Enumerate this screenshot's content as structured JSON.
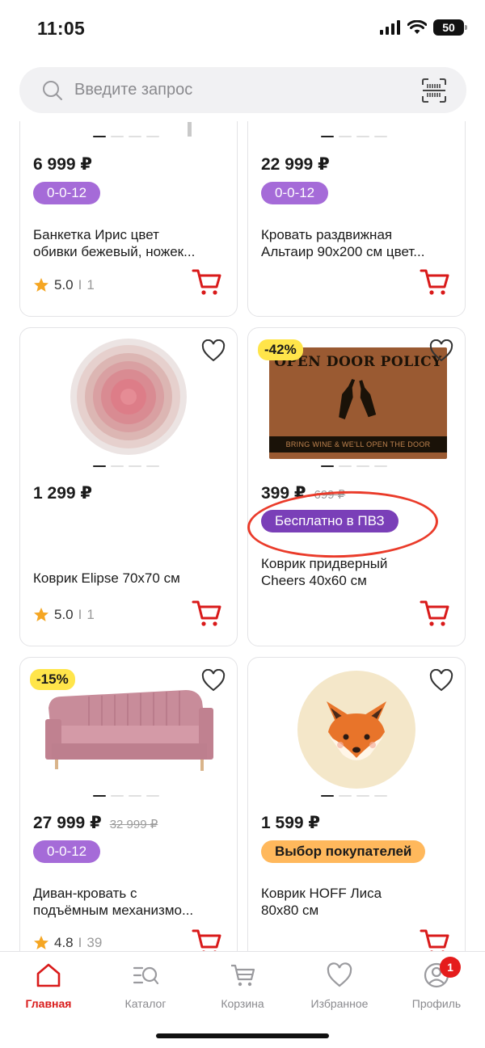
{
  "status_bar": {
    "time": "11:05",
    "battery": "50"
  },
  "search": {
    "placeholder": "Введите запрос"
  },
  "products": [
    {
      "price": "6 999 ₽",
      "old_price": "",
      "badge": "0-0-12",
      "title_line1": "Банкетка Ирис цвет",
      "title_line2": "обивки бежевый, ножек...",
      "rating": "5.0",
      "reviews": "1",
      "discount": ""
    },
    {
      "price": "22 999 ₽",
      "old_price": "",
      "badge": "0-0-12",
      "title_line1": "Кровать раздвижная",
      "title_line2": "Альтаир 90х200 см цвет...",
      "rating": "",
      "reviews": "",
      "discount": ""
    },
    {
      "price": "1 299 ₽",
      "old_price": "",
      "badge": "",
      "title_line1": "Коврик Elipse 70x70 см",
      "title_line2": "",
      "rating": "5.0",
      "reviews": "1",
      "discount": ""
    },
    {
      "price": "399 ₽",
      "old_price": "699 ₽",
      "badge": "Бесплатно в ПВЗ",
      "title_line1": "Коврик придверный",
      "title_line2": "Cheers 40x60 см",
      "rating": "",
      "reviews": "",
      "discount": "-42%",
      "image_text_top": "OPEN DOOR POLICY",
      "image_text_bottom": "BRING WINE & WE'LL OPEN THE DOOR"
    },
    {
      "price": "27 999 ₽",
      "old_price": "32 999 ₽",
      "badge": "0-0-12",
      "title_line1": "Диван-кровать с",
      "title_line2": "подъёмным механизмо...",
      "rating": "4.8",
      "reviews": "39",
      "discount": "-15%"
    },
    {
      "price": "1 599 ₽",
      "old_price": "",
      "badge": "Выбор покупателей",
      "title_line1": "Коврик HOFF Лиса",
      "title_line2": "80x80 см",
      "rating": "",
      "reviews": "",
      "discount": ""
    }
  ],
  "tabbar": {
    "home": "Главная",
    "catalog": "Каталог",
    "cart": "Корзина",
    "favorites": "Избранное",
    "profile": "Профиль",
    "profile_badge": "1"
  },
  "colors": {
    "accent": "#d91a1a",
    "installment": "#a56bd8",
    "free_delivery": "#7a3fb8",
    "choice": "#ffb85c",
    "discount": "#ffe54a"
  }
}
